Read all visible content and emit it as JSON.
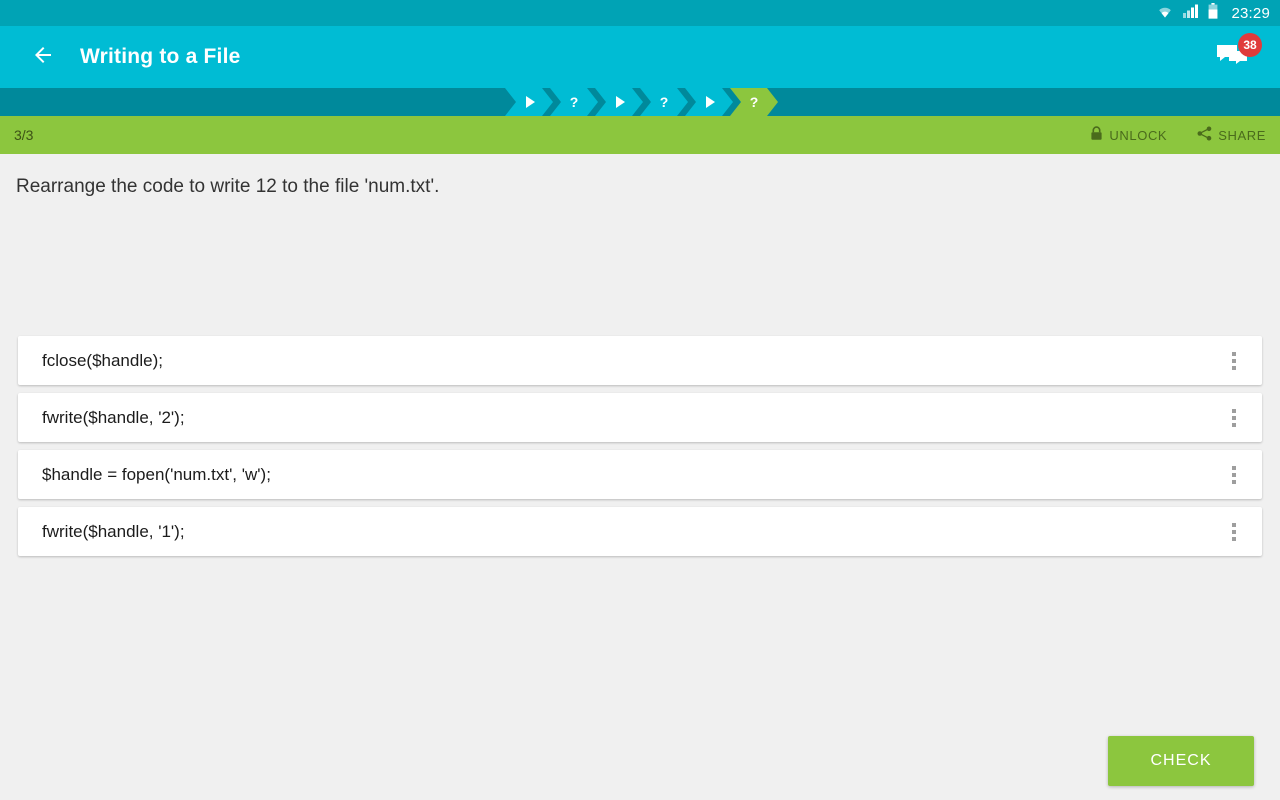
{
  "status_bar": {
    "time": "23:29",
    "icons": [
      "wifi-icon",
      "signal-icon",
      "battery-icon"
    ],
    "background": "#00a3b5"
  },
  "app_bar": {
    "back_icon": "back-arrow-icon",
    "title": "Writing to a File",
    "chat_icon": "chat-bubbles-icon",
    "chat_badge": "38",
    "background": "#00bcd4",
    "badge_color": "#e03b3b"
  },
  "progress": {
    "steps": [
      {
        "type": "play",
        "label": "",
        "state": "done"
      },
      {
        "type": "question",
        "label": "?",
        "state": "done"
      },
      {
        "type": "play",
        "label": "",
        "state": "done"
      },
      {
        "type": "question",
        "label": "?",
        "state": "done"
      },
      {
        "type": "play",
        "label": "",
        "state": "done"
      },
      {
        "type": "question",
        "label": "?",
        "state": "current"
      }
    ],
    "strip_background": "#00899b",
    "done_color": "#00bcd4",
    "current_color": "#8cc63e"
  },
  "toolbar": {
    "counter": "3/3",
    "unlock_label": "UNLOCK",
    "unlock_icon": "lock-icon",
    "share_label": "SHARE",
    "share_icon": "share-icon",
    "background": "#8cc63e",
    "text_color": "#4a6b1c"
  },
  "main": {
    "prompt": "Rearrange the code to write 12 to the file 'num.txt'.",
    "cards": [
      {
        "code": "fclose($handle);",
        "handle_icon": "drag-handle-icon"
      },
      {
        "code": "fwrite($handle, '2');",
        "handle_icon": "drag-handle-icon"
      },
      {
        "code": "$handle = fopen('num.txt', 'w');",
        "handle_icon": "drag-handle-icon"
      },
      {
        "code": "fwrite($handle, '1');",
        "handle_icon": "drag-handle-icon"
      }
    ]
  },
  "footer": {
    "check_label": "CHECK",
    "check_color": "#8cc63e"
  }
}
